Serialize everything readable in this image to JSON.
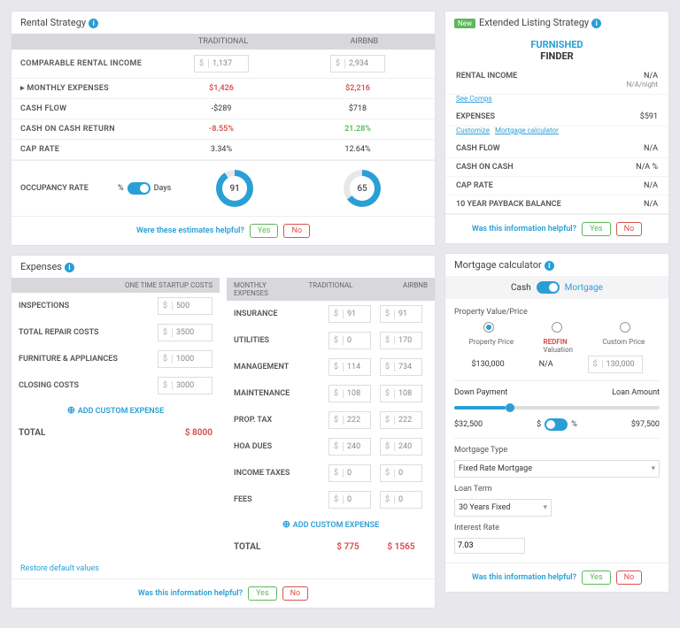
{
  "rental": {
    "title": "Rental Strategy",
    "col1": "TRADITIONAL",
    "col2": "AIRBNB",
    "rows": {
      "cri": "COMPARABLE RENTAL INCOME",
      "me": "▸ MONTHLY EXPENSES",
      "cf": "CASH FLOW",
      "coc": "CASH ON CASH RETURN",
      "cap": "CAP RATE"
    },
    "vals": {
      "cri_t": "1,137",
      "cri_a": "2,934",
      "me_t": "$1,426",
      "me_a": "$2,216",
      "cf_t": "-$289",
      "cf_a": "$718",
      "coc_t": "-8.55%",
      "coc_a": "21.28%",
      "cap_t": "3.34%",
      "cap_a": "12.64%"
    },
    "occ": "OCCUPANCY RATE",
    "occ_pct": "%",
    "occ_days": "Days",
    "d1": "91",
    "d2": "65",
    "fb": "Were these estimates helpful?"
  },
  "ext": {
    "new": "New",
    "title": "Extended Listing Strategy",
    "logo1": "FURNISHED",
    "logo2": "FINDER",
    "ri": "RENTAL INCOME",
    "ri_v": "N/A",
    "ri_s": "N/A/night",
    "sc": "See Comps",
    "ex": "EXPENSES",
    "ex_v": "$591",
    "cust": "Customize",
    "mclink": "Mortgage calculator",
    "cf": "CASH FLOW",
    "cf_v": "N/A",
    "coc": "CASH ON CASH",
    "coc_v": "N/A %",
    "cap": "CAP RATE",
    "cap_v": "N/A",
    "pb": "10 YEAR PAYBACK BALANCE",
    "pb_v": "N/A",
    "fb": "Was this information helpful?"
  },
  "exp": {
    "title": "Expenses",
    "h1": "ONE TIME STARTUP COSTS",
    "h2": "MONTHLY EXPENSES",
    "h2t": "TRADITIONAL",
    "h2a": "AIRBNB",
    "r1": {
      "insp": "INSPECTIONS",
      "trc": "TOTAL REPAIR COSTS",
      "fa": "FURNITURE & APPLIANCES",
      "cc": "CLOSING COSTS"
    },
    "v1": {
      "insp": "500",
      "trc": "3500",
      "fa": "1000",
      "cc": "3000"
    },
    "r2": {
      "ins": "INSURANCE",
      "util": "UTILITIES",
      "mgmt": "MANAGEMENT",
      "maint": "MAINTENANCE",
      "pt": "PROP. TAX",
      "hoa": "HOA DUES",
      "it": "INCOME TAXES",
      "fees": "FEES"
    },
    "v2": {
      "ins_t": "91",
      "ins_a": "91",
      "util_t": "0",
      "util_a": "170",
      "mgmt_t": "114",
      "mgmt_a": "734",
      "maint_t": "108",
      "maint_a": "108",
      "pt_t": "222",
      "pt_a": "222",
      "hoa_t": "240",
      "hoa_a": "240",
      "it_t": "0",
      "it_a": "0",
      "fees_t": "0",
      "fees_a": "0"
    },
    "add": "ADD CUSTOM EXPENSE",
    "tot": "TOTAL",
    "tot1": "$ 8000",
    "tot2t": "$ 775",
    "tot2a": "$ 1565",
    "restore": "Restore default values",
    "fb": "Was this information helpful?"
  },
  "mc": {
    "title": "Mortgage calculator",
    "cash": "Cash",
    "mort": "Mortgage",
    "pvp": "Property Value/Price",
    "pp": "Property Price",
    "rv": "Valuation",
    "cp": "Custom Price",
    "redfin": "REDFIN",
    "pp_v": "$130,000",
    "rv_v": "N/A",
    "cp_v": "130,000",
    "dp": "Down Payment",
    "la": "Loan Amount",
    "dp_v": "$32,500",
    "la_v": "$97,500",
    "dol": "$",
    "pct": "%",
    "mt": "Mortgage Type",
    "mt_v": "Fixed Rate Mortgage",
    "lt": "Loan Term",
    "lt_v": "30 Years Fixed",
    "ir": "Interest Rate",
    "ir_v": "7.03",
    "fb": "Was this information helpful?"
  },
  "btn": {
    "yes": "Yes",
    "no": "No"
  }
}
